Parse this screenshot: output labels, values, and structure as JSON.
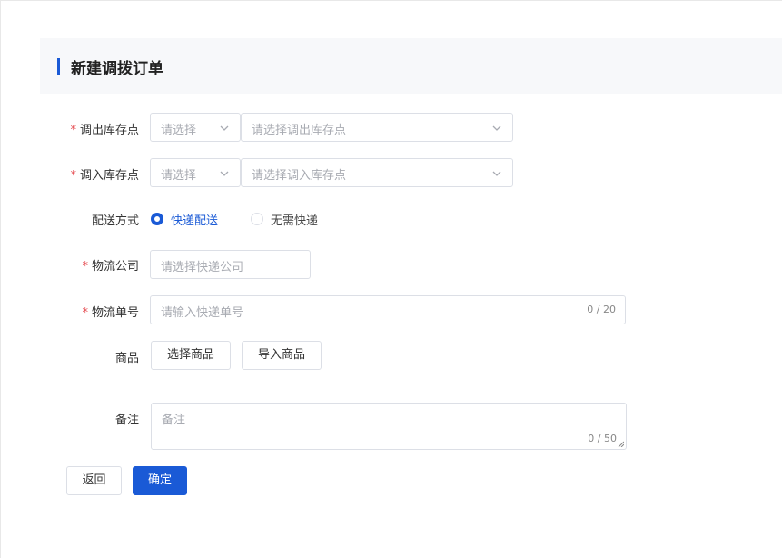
{
  "page": {
    "title": "新建调拨订单",
    "accent_color": "#1a5ad6",
    "required_color": "#e5484d"
  },
  "form": {
    "out_location": {
      "required_mark": "*",
      "label": "调出库存点",
      "type_select": {
        "placeholder": "请选择",
        "icon": "chevron-down-icon"
      },
      "point_select": {
        "placeholder": "请选择调出库存点",
        "icon": "chevron-down-icon"
      }
    },
    "in_location": {
      "required_mark": "*",
      "label": "调入库存点",
      "type_select": {
        "placeholder": "请选择",
        "icon": "chevron-down-icon"
      },
      "point_select": {
        "placeholder": "请选择调入库存点",
        "icon": "chevron-down-icon"
      }
    },
    "delivery": {
      "label": "配送方式",
      "options": [
        {
          "label": "快递配送",
          "selected": true
        },
        {
          "label": "无需快递",
          "selected": false
        }
      ]
    },
    "logistics_company": {
      "required_mark": "*",
      "label": "物流公司",
      "placeholder": "请选择快递公司"
    },
    "tracking_number": {
      "required_mark": "*",
      "label": "物流单号",
      "placeholder": "请输入快递单号",
      "counter": "0 / 20"
    },
    "goods": {
      "label": "商品",
      "select_button": "选择商品",
      "import_button": "导入商品"
    },
    "remark": {
      "label": "备注",
      "placeholder": "备注",
      "counter": "0 / 50"
    }
  },
  "actions": {
    "back_label": "返回",
    "confirm_label": "确定"
  }
}
